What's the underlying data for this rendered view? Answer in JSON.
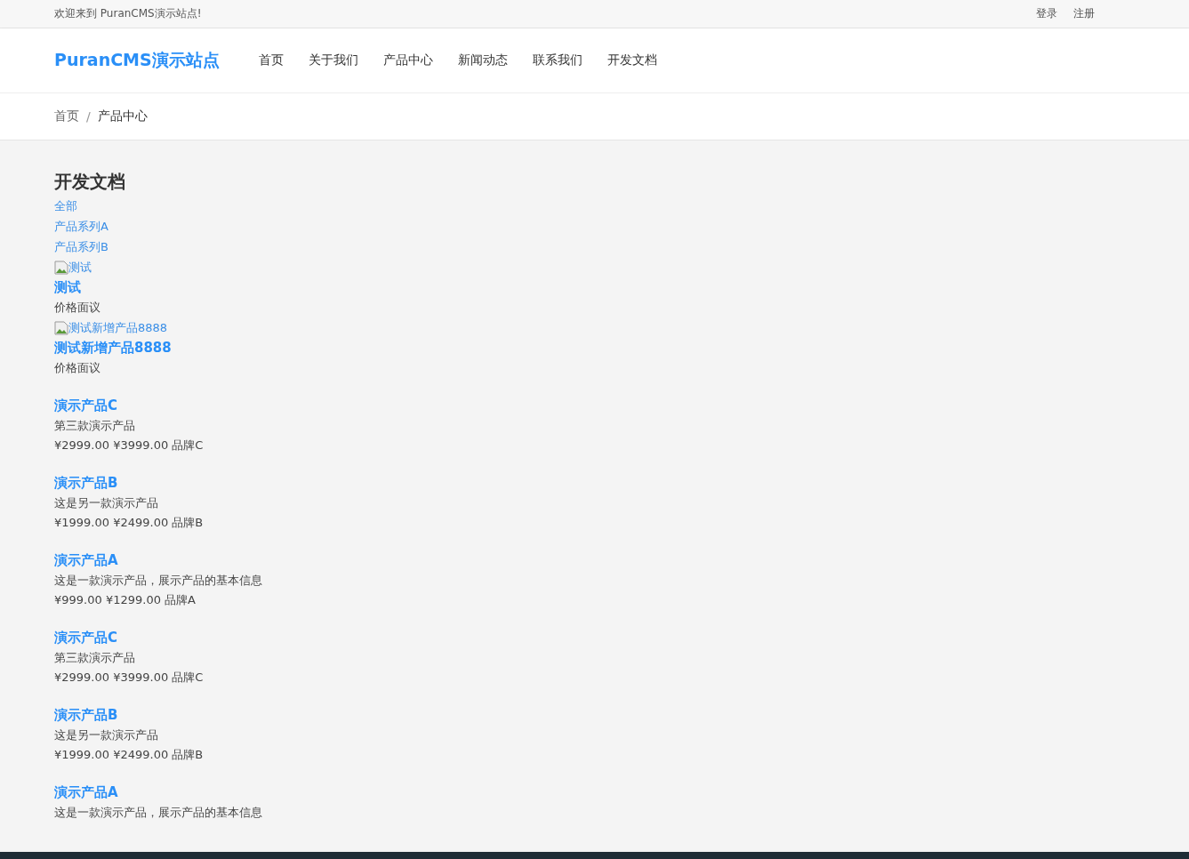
{
  "topbar": {
    "welcome": "欢迎来到 PuranCMS演示站点!",
    "links": [
      "登录",
      "注册"
    ]
  },
  "header": {
    "logo": "PuranCMS演示站点",
    "nav": [
      "首页",
      "关于我们",
      "产品中心",
      "新闻动态",
      "联系我们",
      "开发文档"
    ]
  },
  "breadcrumb": {
    "items": [
      "首页",
      "产品中心"
    ],
    "separator": "/"
  },
  "page_title": "开发文档",
  "categories": [
    "全部",
    "产品系列A",
    "产品系列B"
  ],
  "products": [
    {
      "kind": "image",
      "image_alt": "测试",
      "title": "测试",
      "price": "价格面议"
    },
    {
      "kind": "image",
      "image_alt": "测试新增产品8888",
      "title": "测试新增产品8888",
      "price": "价格面议"
    },
    {
      "kind": "plain",
      "title": "演示产品C",
      "description": "第三款演示产品",
      "price": "¥2999.00 ¥3999.00 品牌C"
    },
    {
      "kind": "plain",
      "title": "演示产品B",
      "description": "这是另一款演示产品",
      "price": "¥1999.00 ¥2499.00 品牌B"
    },
    {
      "kind": "plain",
      "title": "演示产品A",
      "description": "这是一款演示产品，展示产品的基本信息",
      "price": "¥999.00 ¥1299.00 品牌A"
    },
    {
      "kind": "plain",
      "title": "演示产品C",
      "description": "第三款演示产品",
      "price": "¥2999.00 ¥3999.00 品牌C"
    },
    {
      "kind": "plain",
      "title": "演示产品B",
      "description": "这是另一款演示产品",
      "price": "¥1999.00 ¥2499.00 品牌B"
    },
    {
      "kind": "plain",
      "title": "演示产品A",
      "description": "这是一款演示产品，展示产品的基本信息"
    }
  ]
}
